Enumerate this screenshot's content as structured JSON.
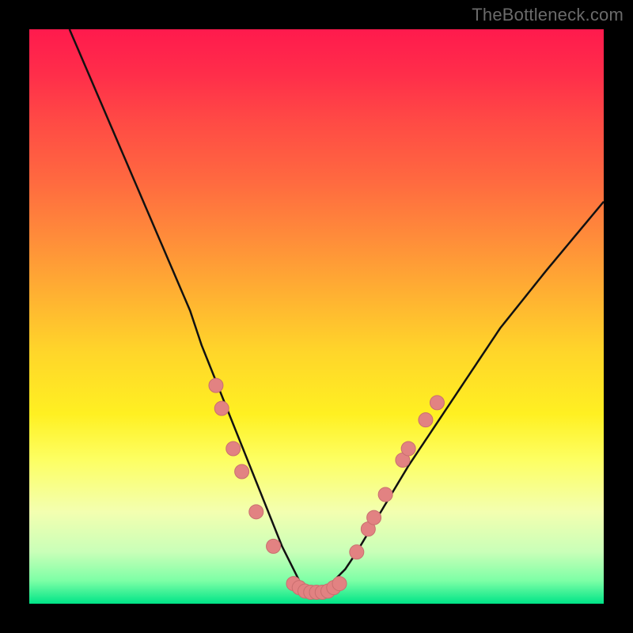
{
  "attribution": "TheBottleneck.com",
  "colors": {
    "frame": "#000000",
    "curve_stroke": "#111111",
    "marker_fill": "#e28282",
    "marker_stroke": "#c96f6f"
  },
  "chart_data": {
    "type": "line",
    "title": "",
    "xlabel": "",
    "ylabel": "",
    "xlim": [
      0,
      100
    ],
    "ylim": [
      0,
      100
    ],
    "series": [
      {
        "name": "bottleneck-curve",
        "x": [
          7,
          10,
          13,
          16,
          19,
          22,
          25,
          28,
          30,
          32,
          34,
          36,
          38,
          40,
          42,
          44,
          46,
          47,
          48,
          49,
          50,
          51,
          52,
          53,
          55,
          57,
          60,
          63,
          66,
          70,
          74,
          78,
          82,
          86,
          90,
          95,
          100
        ],
        "y": [
          100,
          93,
          86,
          79,
          72,
          65,
          58,
          51,
          45,
          40,
          35,
          30,
          25,
          20,
          15,
          10,
          6,
          4,
          3,
          2,
          2,
          2,
          3,
          4,
          6,
          9,
          14,
          19,
          24,
          30,
          36,
          42,
          48,
          53,
          58,
          64,
          70
        ]
      }
    ],
    "markers": [
      {
        "x": 32.5,
        "y": 38
      },
      {
        "x": 33.5,
        "y": 34
      },
      {
        "x": 35.5,
        "y": 27
      },
      {
        "x": 37.0,
        "y": 23
      },
      {
        "x": 39.5,
        "y": 16
      },
      {
        "x": 42.5,
        "y": 10
      },
      {
        "x": 46.0,
        "y": 3.5
      },
      {
        "x": 47.0,
        "y": 2.8
      },
      {
        "x": 48.0,
        "y": 2.2
      },
      {
        "x": 49.0,
        "y": 2.0
      },
      {
        "x": 50.0,
        "y": 2.0
      },
      {
        "x": 51.0,
        "y": 2.0
      },
      {
        "x": 52.0,
        "y": 2.2
      },
      {
        "x": 53.0,
        "y": 2.8
      },
      {
        "x": 54.0,
        "y": 3.5
      },
      {
        "x": 57.0,
        "y": 9
      },
      {
        "x": 59.0,
        "y": 13
      },
      {
        "x": 60.0,
        "y": 15
      },
      {
        "x": 62.0,
        "y": 19
      },
      {
        "x": 65.0,
        "y": 25
      },
      {
        "x": 66.0,
        "y": 27
      },
      {
        "x": 69.0,
        "y": 32
      },
      {
        "x": 71.0,
        "y": 35
      }
    ]
  }
}
